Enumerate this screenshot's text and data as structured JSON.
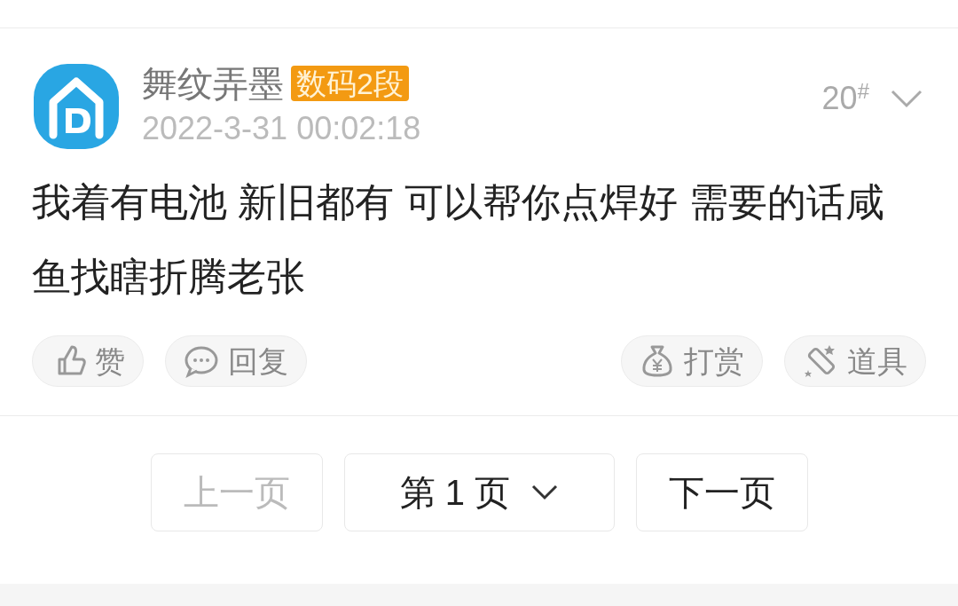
{
  "post": {
    "author": "舞纹弄墨",
    "badge": "数码2段",
    "time": "2022-3-31 00:02:18",
    "floor": "20$^{#}$",
    "content": "我着有电池 新旧都有 可以帮你点焊好 需要的话咸鱼找瞎折腾老张"
  },
  "actions": [
    {
      "kind": "like",
      "label": "赞"
    },
    {
      "kind": "reply",
      "label": "回复"
    },
    {
      "kind": "tip",
      "label": "打赏"
    },
    {
      "kind": "props",
      "label": "道具"
    }
  ],
  "pager": {
    "prev": {
      "label": "上一页",
      "disabled": true
    },
    "page": "第 1 页",
    "next": {
      "label": "下一页",
      "disabled": false
    }
  }
}
